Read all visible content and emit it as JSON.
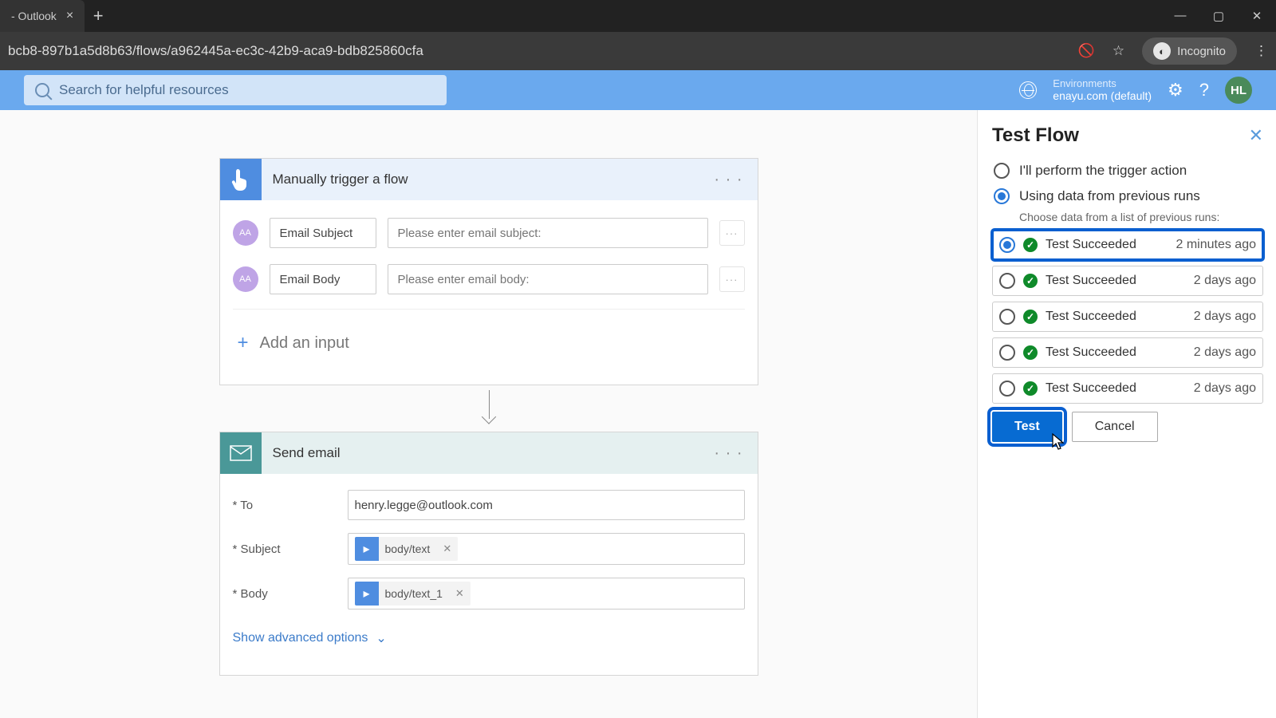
{
  "browser": {
    "tab_title": "- Outlook",
    "url": "bcb8-897b1a5d8b63/flows/a962445a-ec3c-42b9-aca9-bdb825860cfa",
    "incognito_label": "Incognito"
  },
  "header": {
    "search_placeholder": "Search for helpful resources",
    "env_label": "Environments",
    "env_value": "enayu.com (default)",
    "avatar": "HL"
  },
  "trigger": {
    "title": "Manually trigger a flow",
    "inputs": [
      {
        "label": "Email Subject",
        "placeholder": "Please enter email subject:"
      },
      {
        "label": "Email Body",
        "placeholder": "Please enter email body:"
      }
    ],
    "add_input": "Add an input"
  },
  "action": {
    "title": "Send email",
    "fields": {
      "to": {
        "label": "* To",
        "value": "henry.legge@outlook.com"
      },
      "subject": {
        "label": "* Subject",
        "token": "body/text"
      },
      "body": {
        "label": "* Body",
        "token": "body/text_1"
      }
    },
    "advanced": "Show advanced options"
  },
  "panel": {
    "title": "Test Flow",
    "option_manual": "I'll perform the trigger action",
    "option_previous": "Using data from previous runs",
    "previous_hint": "Choose data from a list of previous runs:",
    "runs": [
      {
        "status": "Test Succeeded",
        "time": "2 minutes ago",
        "selected": true
      },
      {
        "status": "Test Succeeded",
        "time": "2 days ago",
        "selected": false
      },
      {
        "status": "Test Succeeded",
        "time": "2 days ago",
        "selected": false
      },
      {
        "status": "Test Succeeded",
        "time": "2 days ago",
        "selected": false
      },
      {
        "status": "Test Succeeded",
        "time": "2 days ago",
        "selected": false
      }
    ],
    "test_btn": "Test",
    "cancel_btn": "Cancel"
  }
}
